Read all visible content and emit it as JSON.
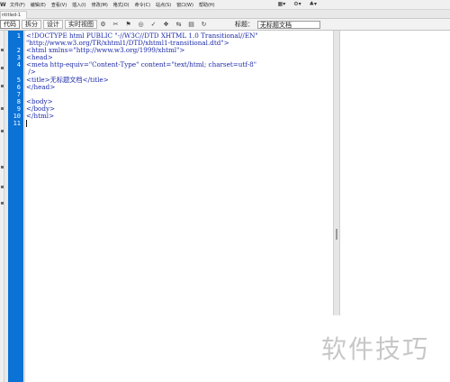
{
  "app": {
    "logo": "W"
  },
  "menu": {
    "items": [
      "文件(F)",
      "编辑(E)",
      "查看(V)",
      "插入(I)",
      "修改(M)",
      "格式(O)",
      "命令(C)",
      "站点(S)",
      "窗口(W)",
      "帮助(H)"
    ],
    "right_icons": [
      "▦▾",
      "⚙▾",
      "♣▾"
    ]
  },
  "tab": {
    "label": "ntitled-1"
  },
  "toolbar": {
    "code": "代码",
    "split": "拆分",
    "design": "设计",
    "live": "实时视图",
    "icons": [
      "⚙",
      "✂",
      "⚑",
      "◎",
      "✓",
      "❖",
      "⇆",
      "▤",
      "↻"
    ],
    "title_label": "标题：",
    "title_value": "无标题文档"
  },
  "editor": {
    "line_numbers": [
      "1",
      "",
      "2",
      "3",
      "4",
      "",
      "5",
      "6",
      "7",
      "8",
      "9",
      "10",
      "11"
    ],
    "lines": [
      "<!DOCTYPE html PUBLIC \"-//W3C//DTD XHTML 1.0 Transitional//EN\"",
      "\"http://www.w3.org/TR/xhtml1/DTD/xhtml1-transitional.dtd\">",
      "<html xmlns=\"http://www.w3.org/1999/xhtml\">",
      "<head>",
      "<meta http-equiv=\"Content-Type\" content=\"text/html; charset=utf-8\"",
      " />",
      "<title>无标题文档</title>",
      "</head>",
      "",
      "<body>",
      "</body>",
      "</html>",
      ""
    ]
  },
  "watermark": "软件技巧"
}
